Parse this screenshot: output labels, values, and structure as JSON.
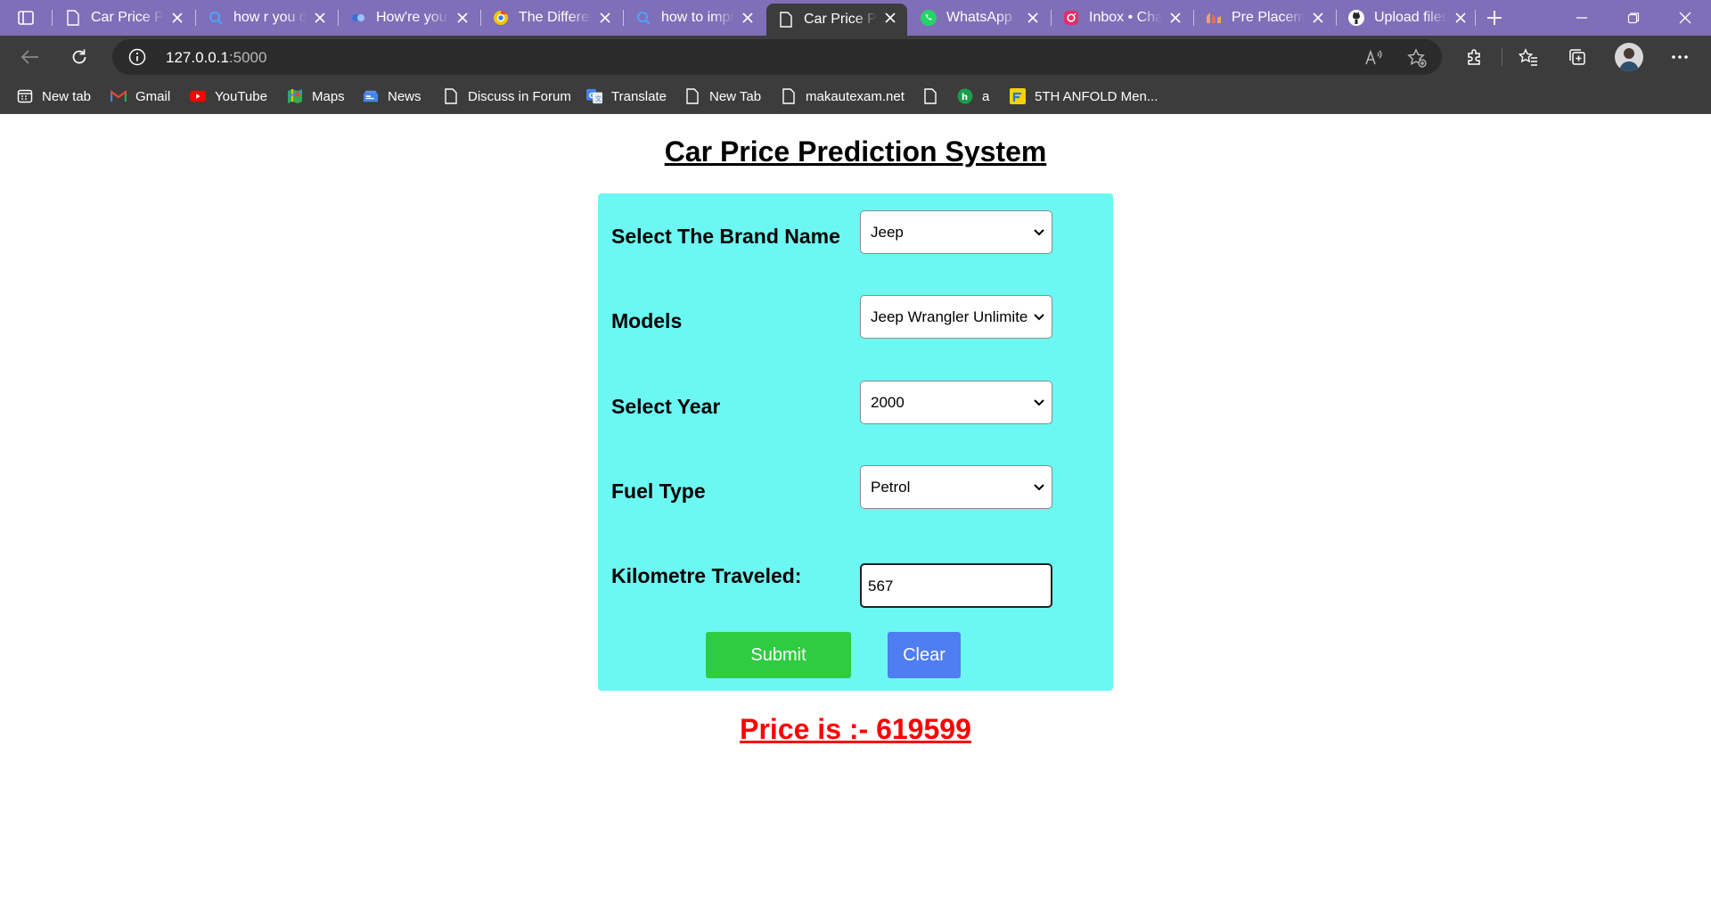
{
  "browser": {
    "tabs": [
      {
        "title": "Car Price Prediction",
        "icon": "page-icon"
      },
      {
        "title": "how r you doing",
        "icon": "search-icon"
      },
      {
        "title": "How're you",
        "icon": "site-icon"
      },
      {
        "title": "The Difference",
        "icon": "chrome-icon"
      },
      {
        "title": "how to improve",
        "icon": "search-icon"
      },
      {
        "title": "Car Price Prediction",
        "icon": "page-icon",
        "active": true
      },
      {
        "title": "WhatsApp",
        "icon": "whatsapp-icon"
      },
      {
        "title": "Inbox • Chats",
        "icon": "instagram-icon"
      },
      {
        "title": "Pre Placement",
        "icon": "site-icon"
      },
      {
        "title": "Upload files",
        "icon": "github-icon"
      }
    ],
    "address": {
      "host": "127.0.0.1",
      "port": ":5000"
    },
    "bookmarks": [
      {
        "label": "New tab",
        "icon": "newtab-icon"
      },
      {
        "label": "Gmail",
        "icon": "gmail-icon"
      },
      {
        "label": "YouTube",
        "icon": "youtube-icon"
      },
      {
        "label": "Maps",
        "icon": "maps-icon"
      },
      {
        "label": "News",
        "icon": "news-icon"
      },
      {
        "label": "Discuss in Forum",
        "icon": "page-icon"
      },
      {
        "label": "Translate",
        "icon": "translate-icon"
      },
      {
        "label": "New Tab",
        "icon": "page-icon"
      },
      {
        "label": "makautexam.net",
        "icon": "page-icon"
      },
      {
        "label": "",
        "icon": "page-icon"
      },
      {
        "label": "a",
        "icon": "site-icon"
      },
      {
        "label": "5TH ANFOLD Men...",
        "icon": "flipkart-icon"
      }
    ]
  },
  "page": {
    "title": "Car Price Prediction System",
    "form": {
      "brand_label": "Select The Brand Name",
      "brand_value": "Jeep",
      "model_label": "Models",
      "model_value": "Jeep Wrangler Unlimited",
      "year_label": "Select Year",
      "year_value": "2000",
      "fuel_label": "Fuel Type",
      "fuel_value": "Petrol",
      "km_label": "Kilometre Traveled:",
      "km_value": "567",
      "submit_label": "Submit",
      "clear_label": "Clear"
    },
    "result": "Price is :- 619599"
  },
  "colors": {
    "panel": "#6cf8f2",
    "submit": "#2ecc40",
    "clear": "#4f7df2",
    "result": "#ff0000",
    "tabbar": "#7e6fb8"
  }
}
